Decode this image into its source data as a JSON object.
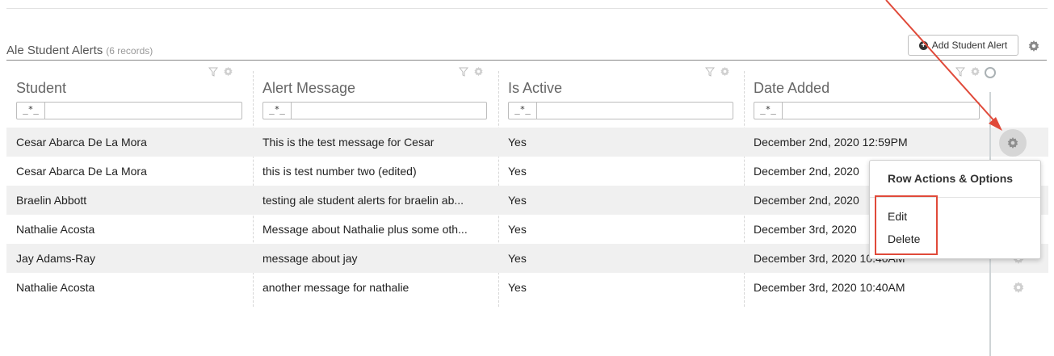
{
  "panel": {
    "title": "Ale Student Alerts",
    "record_count": "(6 records)",
    "add_button_label": "Add Student Alert"
  },
  "columns": [
    {
      "label": "Student",
      "filter_op": "_*_",
      "filter_value": ""
    },
    {
      "label": "Alert Message",
      "filter_op": "_*_",
      "filter_value": ""
    },
    {
      "label": "Is Active",
      "filter_op": "_*_",
      "filter_value": ""
    },
    {
      "label": "Date Added",
      "filter_op": "_*_",
      "filter_value": ""
    }
  ],
  "rows": [
    {
      "student": "Cesar Abarca De La Mora",
      "message": "This is the test message for Cesar",
      "active": "Yes",
      "date": "December 2nd, 2020 12:59PM"
    },
    {
      "student": "Cesar Abarca De La Mora",
      "message": "this is test number two (edited)",
      "active": "Yes",
      "date": "December 2nd, 2020"
    },
    {
      "student": "Braelin Abbott",
      "message": "testing ale student alerts for braelin ab...",
      "active": "Yes",
      "date": "December 2nd, 2020"
    },
    {
      "student": "Nathalie Acosta",
      "message": "Message about Nathalie plus some oth...",
      "active": "Yes",
      "date": "December 3rd, 2020"
    },
    {
      "student": "Jay Adams-Ray",
      "message": "message about jay",
      "active": "Yes",
      "date": "December 3rd, 2020 10:40AM"
    },
    {
      "student": "Nathalie Acosta",
      "message": "another message for nathalie",
      "active": "Yes",
      "date": "December 3rd, 2020 10:40AM"
    }
  ],
  "row_menu": {
    "title": "Row Actions & Options",
    "items": [
      "Edit",
      "Delete"
    ]
  },
  "colors": {
    "annotation": "#e04a3a",
    "row_stripe": "#f0f0f0",
    "gear": "#a9a9a9"
  },
  "icons": [
    "plus-circle-icon",
    "gear-icon",
    "filter-icon",
    "arrow-annotation"
  ]
}
